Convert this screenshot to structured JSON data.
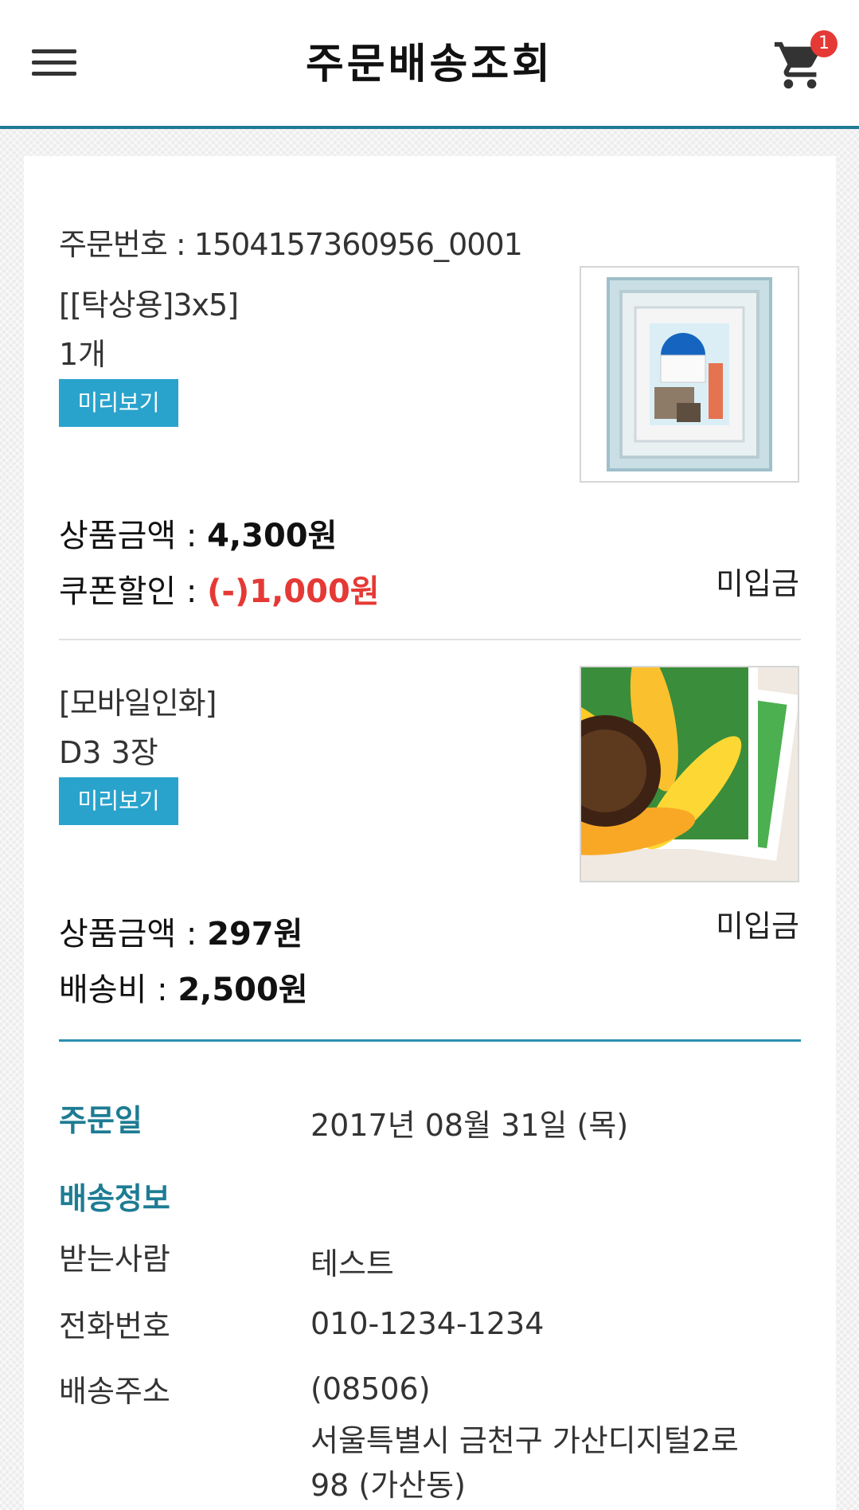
{
  "header": {
    "title": "주문배송조회",
    "cart_count": "1"
  },
  "order": {
    "order_number": "주문번호 : 1504157360956_0001",
    "items": [
      {
        "name": "[[탁상용]3x5]",
        "quantity": "1개",
        "preview_label": "미리보기",
        "price_label": "상품금액 : ",
        "price_value": "4,300원",
        "discount_label": "쿠폰할인 : ",
        "discount_value": "(-)1,000원",
        "status": "미입금",
        "image_icon": "framed-photo-icon"
      },
      {
        "name": "[모바일인화]",
        "quantity": "D3 3장",
        "preview_label": "미리보기",
        "price_label": "상품금액 : ",
        "price_value": "297원",
        "shipping_label": "배송비 : ",
        "shipping_value": "2,500원",
        "status": "미입금",
        "image_icon": "sunflower-photo-icon"
      }
    ],
    "order_date_label": "주문일",
    "order_date": "2017년 08월 31일 (목)",
    "shipping_section": "배송정보",
    "recipient_label": "받는사람",
    "recipient": "테스트",
    "phone_label": "전화번호",
    "phone": "010-1234-1234",
    "address_label": "배송주소",
    "postcode": "(08506)",
    "address_line1": "서울특별시 금천구 가산디지털2로",
    "address_line2": "98 (가산동)"
  },
  "colors": {
    "accent": "#1f7b93",
    "button": "#29a3cc",
    "discount": "#e53935",
    "badge": "#e53935"
  }
}
